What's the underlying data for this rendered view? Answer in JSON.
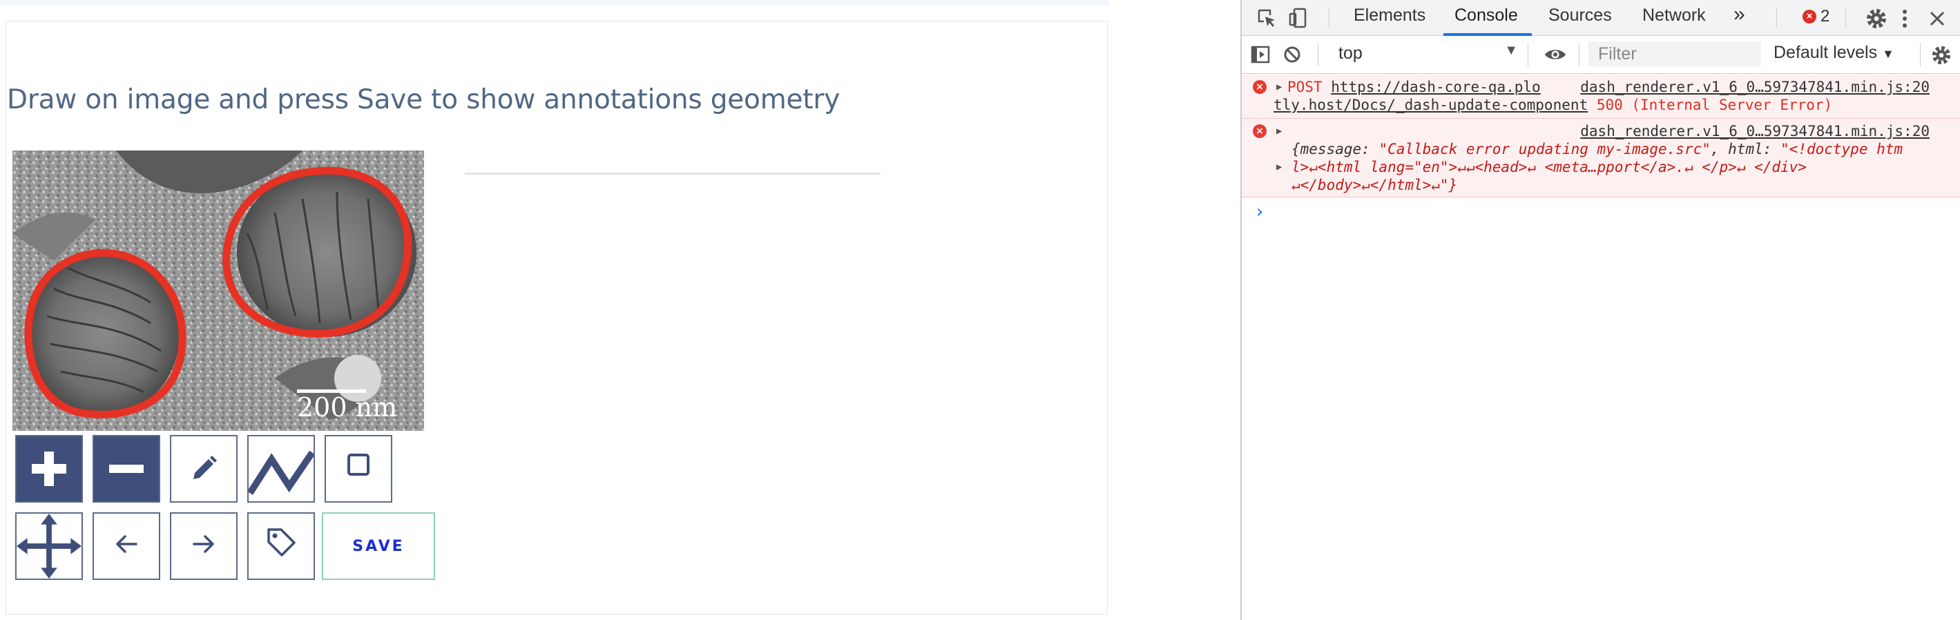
{
  "page": {
    "heading": "Draw on image and press Save to show annotations geometry",
    "scale_bar_label": "200 nm",
    "toolbar": {
      "zoom_in_icon": "plus-icon",
      "zoom_out_icon": "minus-icon",
      "draw_freeform_icon": "pencil-icon",
      "draw_line_icon": "zigzag-line-icon",
      "draw_rect_icon": "square-icon",
      "pan_icon": "move-arrows-icon",
      "undo_icon": "arrow-left-icon",
      "redo_icon": "arrow-right-icon",
      "label_icon": "tag-icon",
      "save_label": "SAVE"
    },
    "colors": {
      "heading": "#506784",
      "toolbar_dark": "#3f4e7a",
      "annotation_stroke": "#e53224",
      "save_text": "#1a2fd8"
    }
  },
  "devtools": {
    "tabs": [
      "Elements",
      "Console",
      "Sources",
      "Network"
    ],
    "active_tab": "Console",
    "more_tabs": "»",
    "error_count": "2",
    "context": "top",
    "filter_placeholder": "Filter",
    "levels": "Default levels",
    "messages": [
      {
        "type": "error",
        "method": "POST",
        "url_part1": "https://dash-core-qa.plo",
        "url_part2": "tly.host/Docs/_dash-update-component",
        "status": "500 (Internal Server Error)",
        "source": "dash_renderer.v1_6_0…597347841.min.js:20"
      },
      {
        "type": "error",
        "source": "dash_renderer.v1_6_0…597347841.min.js:20",
        "line1_key": "{message: ",
        "line1_val": "\"Callback error updating my-image.src\"",
        "line1_key2": ", html: ",
        "line1_val2": "\"<!doctype htm",
        "line2": "l>↵<html lang=\"en\">↵↵<head>↵    <meta…pport</a>.↵      </p>↵    </div>",
        "line3": "↵</body>↵</html>↵\"}"
      }
    ],
    "prompt_symbol": "›"
  }
}
